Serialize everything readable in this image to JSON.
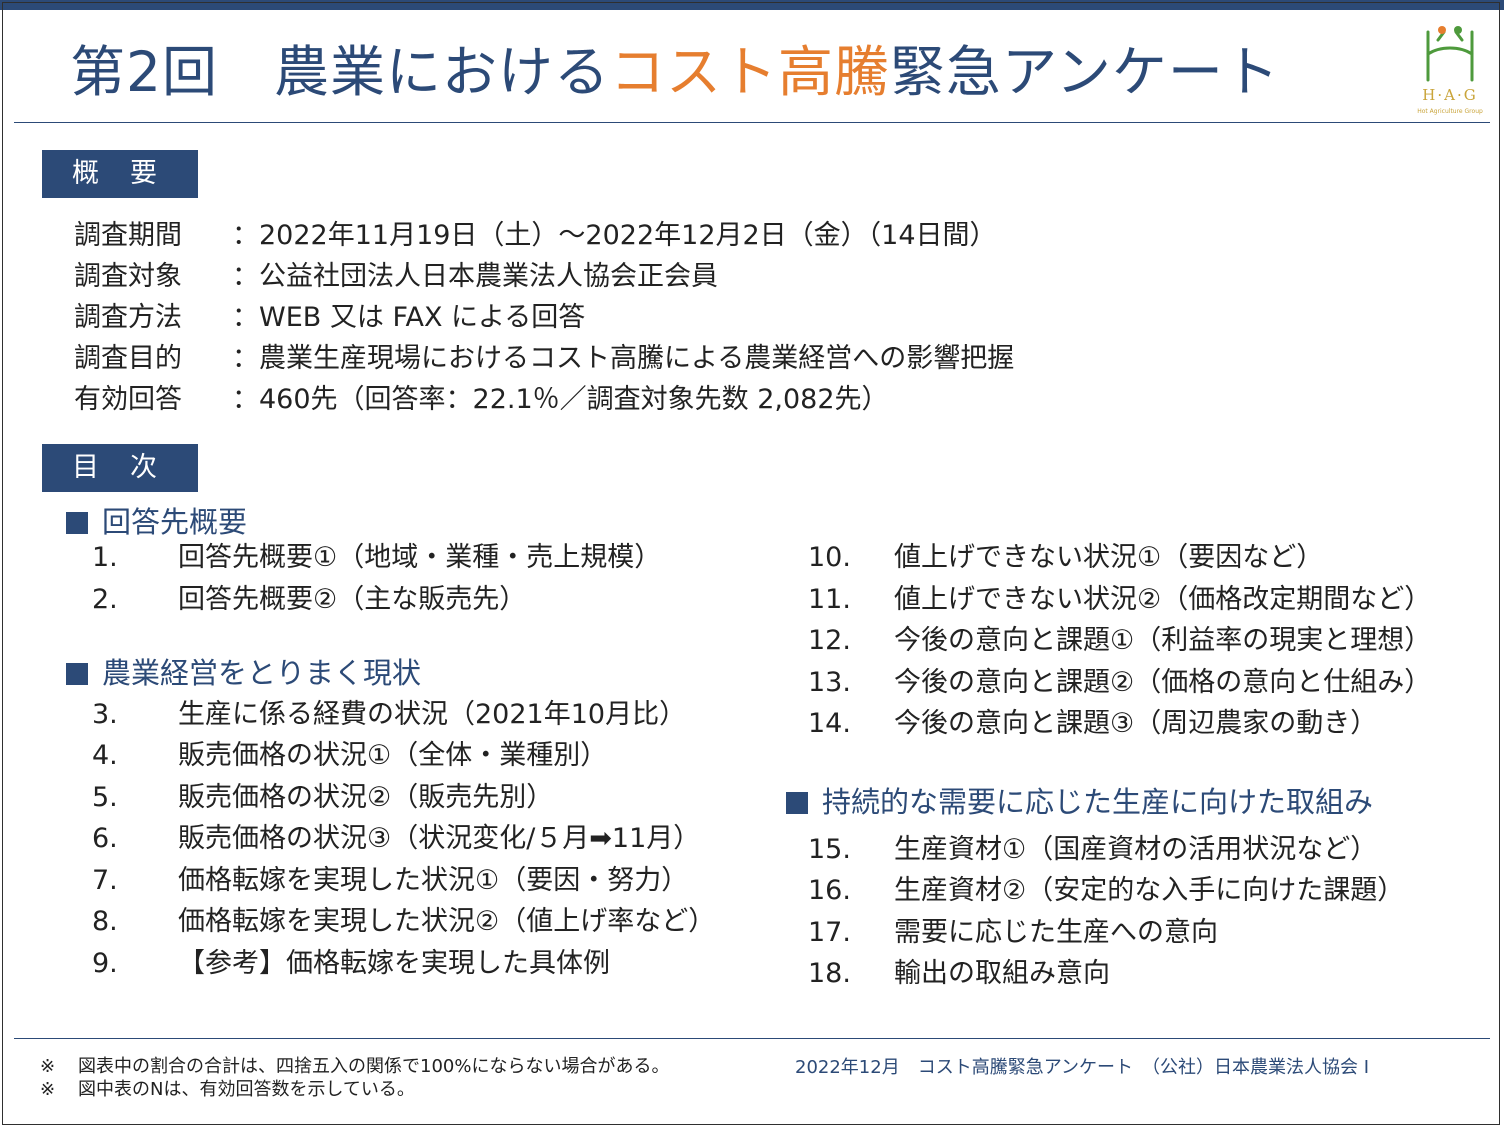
{
  "title": {
    "prefix": "第2回",
    "part1": "農業における",
    "accent": "コスト高騰",
    "part2": "緊急アンケート"
  },
  "logo": {
    "letters": "H·A·G",
    "subtitle": "Hot Agriculture Group",
    "color": "#c9a43a"
  },
  "overview": {
    "label": "概　要",
    "rows": [
      {
        "key": "調査期間",
        "value": "：2022年11月19日（土）～2022年12月2日（金）（14日間）"
      },
      {
        "key": "調査対象",
        "value": "：公益社団法人日本農業法人協会正会員"
      },
      {
        "key": "調査方法",
        "value": "：WEB 又は FAX による回答"
      },
      {
        "key": "調査目的",
        "value": "：農業生産現場におけるコスト高騰による農業経営への影響把握"
      },
      {
        "key": "有効回答",
        "value": "：460先（回答率：22.1％／調査対象先数 2,082先）"
      }
    ]
  },
  "toc": {
    "label": "目　次",
    "groups": [
      {
        "heading": "回答先概要"
      },
      {
        "heading": "農業経営をとりまく現状"
      },
      {
        "heading": "持続的な需要に応じた生産に向けた取組み"
      }
    ],
    "items": [
      {
        "num": "1.",
        "text": "回答先概要①（地域・業種・売上規模）"
      },
      {
        "num": "2.",
        "text": "回答先概要②（主な販売先）"
      },
      {
        "num": "3.",
        "text": "生産に係る経費の状況（2021年10月比）"
      },
      {
        "num": "4.",
        "text": "販売価格の状況①（全体・業種別）"
      },
      {
        "num": "5.",
        "text": "販売価格の状況②（販売先別）"
      },
      {
        "num": "6.",
        "text": "販売価格の状況③（状況変化/５月➡11月）"
      },
      {
        "num": "7.",
        "text": "価格転嫁を実現した状況①（要因・努力）"
      },
      {
        "num": "8.",
        "text": "価格転嫁を実現した状況②（値上げ率など）"
      },
      {
        "num": "9.",
        "text": "【参考】価格転嫁を実現した具体例"
      },
      {
        "num": "10.",
        "text": "値上げできない状況①（要因など）"
      },
      {
        "num": "11.",
        "text": "値上げできない状況②（価格改定期間など）"
      },
      {
        "num": "12.",
        "text": "今後の意向と課題①（利益率の現実と理想）"
      },
      {
        "num": "13.",
        "text": "今後の意向と課題②（価格の意向と仕組み）"
      },
      {
        "num": "14.",
        "text": "今後の意向と課題③（周辺農家の動き）"
      },
      {
        "num": "15.",
        "text": "生産資材①（国産資材の活用状況など）"
      },
      {
        "num": "16.",
        "text": "生産資材②（安定的な入手に向けた課題）"
      },
      {
        "num": "17.",
        "text": "需要に応じた生産への意向"
      },
      {
        "num": "18.",
        "text": "輸出の取組み意向"
      }
    ]
  },
  "notes": [
    {
      "mark": "※",
      "text": "図表中の割合の合計は、四捨五入の関係で100%にならない場合がある。"
    },
    {
      "mark": "※",
      "text": "図中表のNは、有効回答数を示している。"
    }
  ],
  "footer": "2022年12月　コスト高騰緊急アンケート　（公社）日本農業法人協会 I",
  "colors": {
    "primary": "#2c4a77",
    "accent": "#e67e2f"
  }
}
